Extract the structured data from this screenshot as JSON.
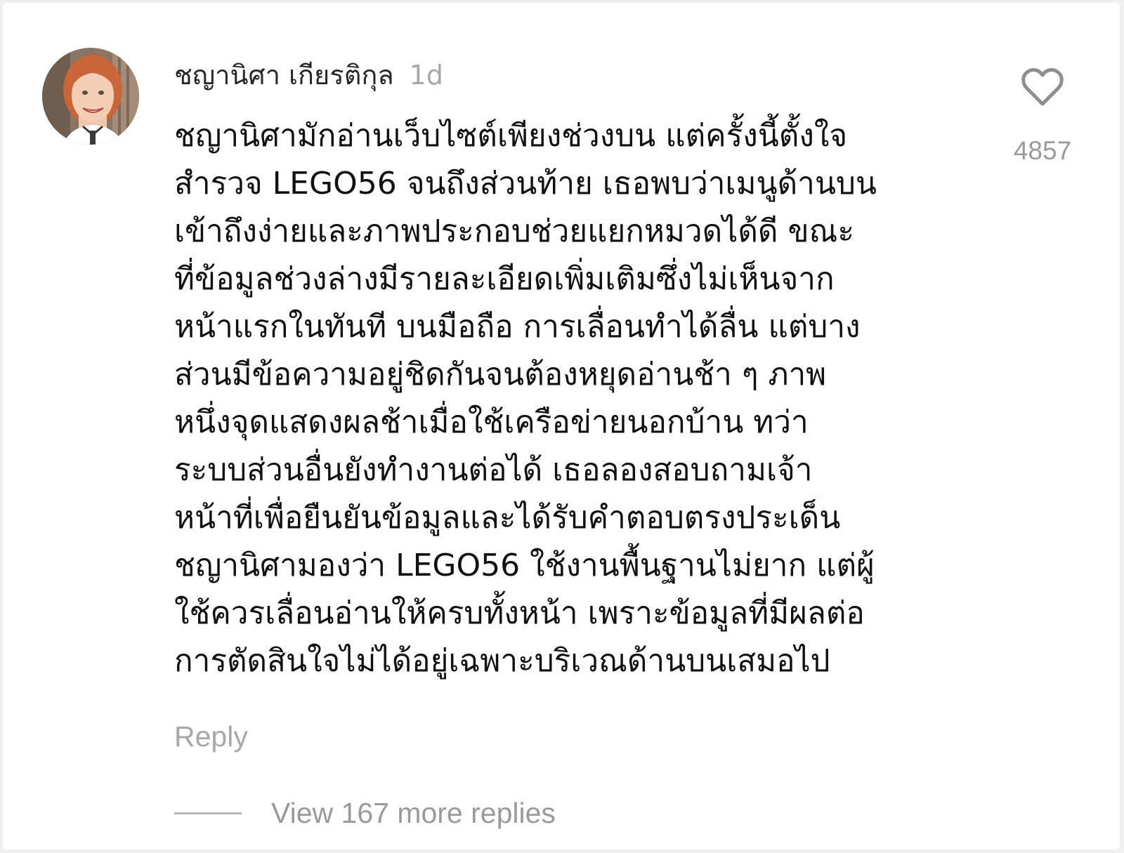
{
  "comment": {
    "username": "ชญานิศา เกียรติกุล",
    "time": "1d",
    "lines": [
      "ชญานิศามักอ่านเว็บไซต์เพียงช่วงบน แต่ครั้งนี้ตั้งใจ",
      "สำรวจ LEGO56 จนถึงส่วนท้าย เธอพบว่าเมนูด้านบน",
      "เข้าถึงง่ายและภาพประกอบช่วยแยกหมวดได้ดี ขณะ",
      "ที่ข้อมูลช่วงล่างมีรายละเอียดเพิ่มเติมซึ่งไม่เห็นจาก",
      "หน้าแรกในทันที บนมือถือ การเลื่อนทำได้ลื่น แต่บาง",
      "ส่วนมีข้อความอยู่ชิดกันจนต้องหยุดอ่านช้า ๆ ภาพ",
      "หนึ่งจุดแสดงผลช้าเมื่อใช้เครือข่ายนอกบ้าน ทว่า",
      "ระบบส่วนอื่นยังทำงานต่อได้ เธอลองสอบถามเจ้า",
      "หน้าที่เพื่อยืนยันข้อมูลและได้รับคำตอบตรงประเด็น",
      "ชญานิศามองว่า LEGO56 ใช้งานพื้นฐานไม่ยาก แต่ผู้",
      "ใช้ควรเลื่อนอ่านให้ครบทั้งหน้า เพราะข้อมูลที่มีผลต่อ",
      "การตัดสินใจไม่ได้อยู่เฉพาะบริเวณด้านบนเสมอไป"
    ],
    "like_count": "4857",
    "reply_label": "Reply",
    "view_replies_label": "View 167 more replies"
  },
  "icons": {
    "like": "heart-outline-icon",
    "avatar": "profile-photo"
  },
  "colors": {
    "background": "#ffffff",
    "username": "#262626",
    "body_text": "#111111",
    "muted": "#a8a8a8"
  }
}
